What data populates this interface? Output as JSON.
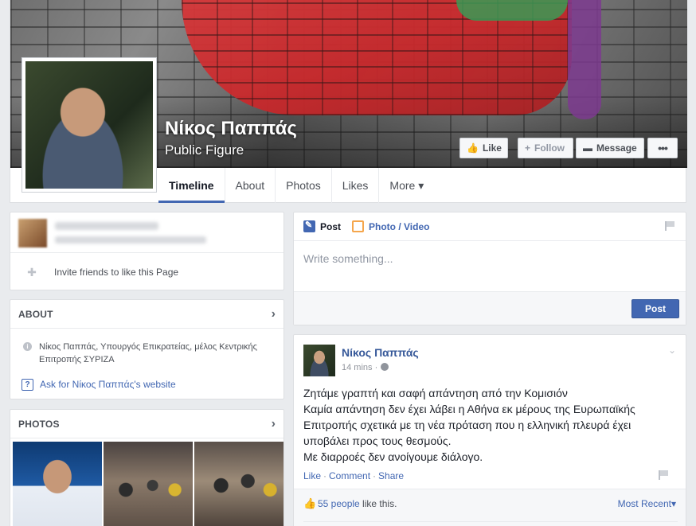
{
  "page": {
    "name": "Νίκος Παππάς",
    "category": "Public Figure"
  },
  "cover_buttons": {
    "like": "Like",
    "follow": "Follow",
    "message": "Message",
    "more": "•••"
  },
  "tabs": [
    "Timeline",
    "About",
    "Photos",
    "Likes",
    "More ▾"
  ],
  "left": {
    "invite": "Invite friends to like this Page",
    "about": {
      "title": "ABOUT",
      "description": "Νίκος Παππάς, Υπουργός Επικρατείας, μέλος Κεντρικής Επιτροπής ΣΥΡΙΖΑ",
      "website_prompt": "Ask for Νίκος Παππάς's website"
    },
    "photos": {
      "title": "PHOTOS"
    }
  },
  "composer": {
    "tab_post": "Post",
    "tab_photo": "Photo / Video",
    "placeholder": "Write something...",
    "post_button": "Post"
  },
  "post": {
    "author": "Νίκος Παππάς",
    "time": "14 mins ·",
    "lines": [
      "Ζητάμε γραπτή και σαφή απάντηση από την Κομισιόν",
      "Καμία απάντηση δεν έχει λάβει η Αθήνα εκ μέρους της Ευρωπαϊκής",
      "Επιτροπής σχετικά με τη νέα πρόταση που η ελληνική πλευρά έχει",
      "υποβάλει προς τους θεσμούς.",
      "Με διαρροές δεν ανοίγουμε διάλογο."
    ],
    "action_like": "Like",
    "action_comment": "Comment",
    "action_share": "Share",
    "likes_people": "55 people",
    "likes_suffix": " like this.",
    "most_recent": "Most Recent▾"
  },
  "colors": {
    "brand_blue": "#4267b2",
    "link_blue": "#365899",
    "background": "#e9ebee"
  }
}
